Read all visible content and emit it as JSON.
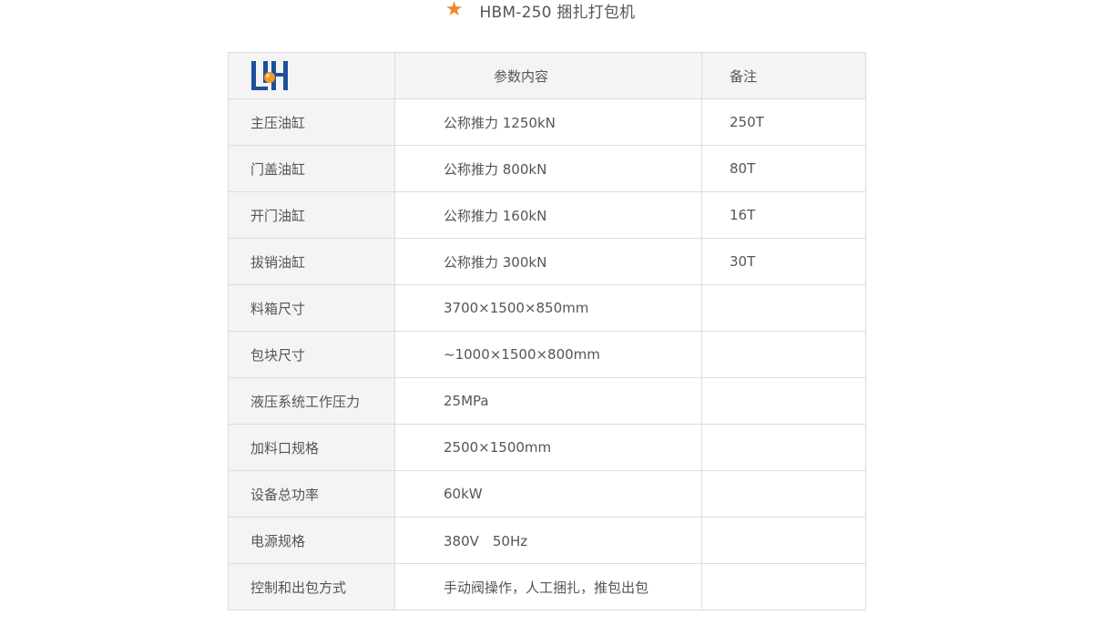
{
  "header": {
    "title": "HBM-250 捆扎打包机",
    "star_icon": "star-icon",
    "star_color": "#e98a2f"
  },
  "table": {
    "logo_icon": "company-logo-icon",
    "header_param": "参数内容",
    "header_note": "备注",
    "rows": [
      {
        "name": "主压油缸",
        "value": "公称推力 1250kN",
        "note": "250T"
      },
      {
        "name": "门盖油缸",
        "value": "公称推力 800kN",
        "note": "80T"
      },
      {
        "name": "开门油缸",
        "value": "公称推力 160kN",
        "note": "16T"
      },
      {
        "name": "拔销油缸",
        "value": "公称推力 300kN",
        "note": "30T"
      },
      {
        "name": "料箱尺寸",
        "value": "3700×1500×850mm",
        "note": ""
      },
      {
        "name": "包块尺寸",
        "value": "~1000×1500×800mm",
        "note": ""
      },
      {
        "name": "液压系统工作压力",
        "value": "25MPa",
        "note": ""
      },
      {
        "name": "加料口规格",
        "value": "2500×1500mm",
        "note": ""
      },
      {
        "name": "设备总功率",
        "value": "60kW",
        "note": ""
      },
      {
        "name": "电源规格",
        "value": "380V　50Hz",
        "note": ""
      },
      {
        "name": "控制和出包方式",
        "value": "手动阀操作，人工捆扎，推包出包",
        "note": ""
      }
    ]
  },
  "colors": {
    "logo_blue": "#1d4f9c",
    "logo_orange": "#f39a1e",
    "border": "#dddddd",
    "header_bg": "#f4f4f4"
  }
}
